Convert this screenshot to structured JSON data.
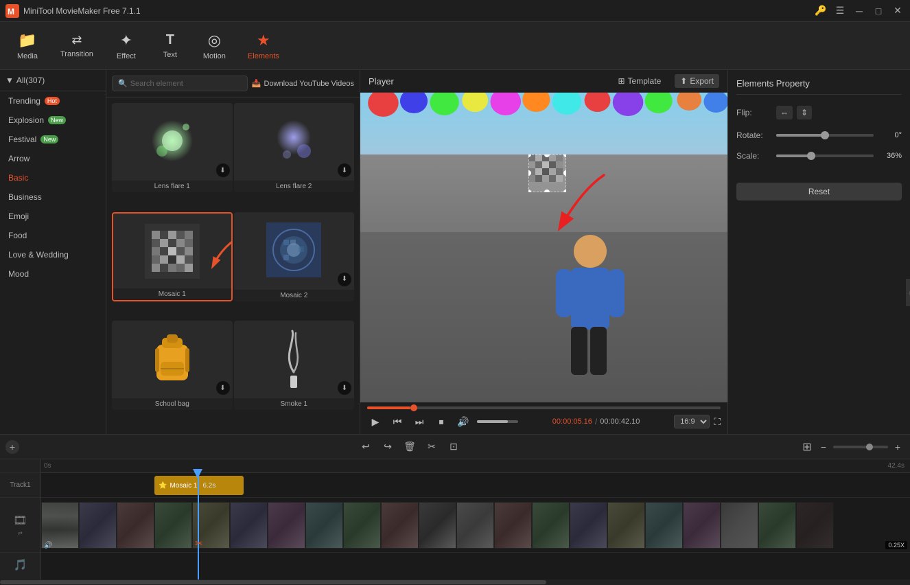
{
  "app": {
    "title": "MiniTool MovieMaker Free 7.1.1"
  },
  "titlebar": {
    "controls": {
      "settings": "⚙",
      "menu": "☰",
      "minimize": "─",
      "maximize": "□",
      "close": "✕"
    }
  },
  "toolbar": {
    "items": [
      {
        "id": "media",
        "icon": "🎞",
        "label": "Media",
        "active": false
      },
      {
        "id": "transition",
        "icon": "⇄",
        "label": "Transition",
        "active": false
      },
      {
        "id": "effect",
        "icon": "✦",
        "label": "Effect",
        "active": false
      },
      {
        "id": "text",
        "icon": "T",
        "label": "Text",
        "active": false
      },
      {
        "id": "motion",
        "icon": "◎",
        "label": "Motion",
        "active": false
      },
      {
        "id": "elements",
        "icon": "★",
        "label": "Elements",
        "active": true
      }
    ]
  },
  "sidebar": {
    "header": "All(307)",
    "items": [
      {
        "label": "Trending",
        "badge": "Hot",
        "badge_type": "hot",
        "active": false
      },
      {
        "label": "Explosion",
        "badge": "New",
        "badge_type": "new",
        "active": false
      },
      {
        "label": "Festival",
        "badge": "New",
        "badge_type": "new",
        "active": false
      },
      {
        "label": "Arrow",
        "badge": null,
        "active": false
      },
      {
        "label": "Basic",
        "badge": null,
        "active": true
      },
      {
        "label": "Business",
        "badge": null,
        "active": false
      },
      {
        "label": "Emoji",
        "badge": null,
        "active": false
      },
      {
        "label": "Food",
        "badge": null,
        "active": false
      },
      {
        "label": "Love & Wedding",
        "badge": null,
        "active": false
      },
      {
        "label": "Mood",
        "badge": null,
        "active": false
      }
    ]
  },
  "elements_panel": {
    "search_placeholder": "Search element",
    "download_btn": "Download YouTube Videos",
    "items": [
      {
        "id": "lens1",
        "label": "Lens flare 1",
        "selected": false
      },
      {
        "id": "lens2",
        "label": "Lens flare 2",
        "selected": false
      },
      {
        "id": "mosaic1",
        "label": "Mosaic 1",
        "selected": true
      },
      {
        "id": "mosaic2",
        "label": "Mosaic 2",
        "selected": false
      },
      {
        "id": "schoolbag",
        "label": "School bag",
        "selected": false
      },
      {
        "id": "smoke1",
        "label": "Smoke 1",
        "selected": false
      }
    ]
  },
  "player": {
    "title": "Player",
    "time_current": "00:00:05.16",
    "time_total": "00:00:42.10",
    "progress_pct": 12.3,
    "volume_pct": 75,
    "aspect_ratio": "16:9",
    "template_btn": "Template",
    "export_btn": "Export"
  },
  "properties": {
    "title": "Elements Property",
    "flip_label": "Flip:",
    "rotate_label": "Rotate:",
    "rotate_value": "0°",
    "rotate_pct": 0,
    "scale_label": "Scale:",
    "scale_value": "36%",
    "scale_pct": 36,
    "reset_btn": "Reset"
  },
  "timeline": {
    "start_time": "0s",
    "end_time": "42.4s",
    "track1_label": "Track1",
    "clip_label": "⭐ Mosaic 1",
    "clip_duration": "6.2s",
    "speed_badge": "0.25X",
    "tools": [
      {
        "id": "undo",
        "icon": "↩",
        "label": "undo"
      },
      {
        "id": "redo",
        "icon": "↪",
        "label": "redo"
      },
      {
        "id": "delete",
        "icon": "🗑",
        "label": "delete"
      },
      {
        "id": "cut",
        "icon": "✂",
        "label": "cut"
      },
      {
        "id": "crop",
        "icon": "⊡",
        "label": "crop"
      }
    ],
    "zoom": {
      "minus": "−",
      "plus": "+"
    }
  }
}
